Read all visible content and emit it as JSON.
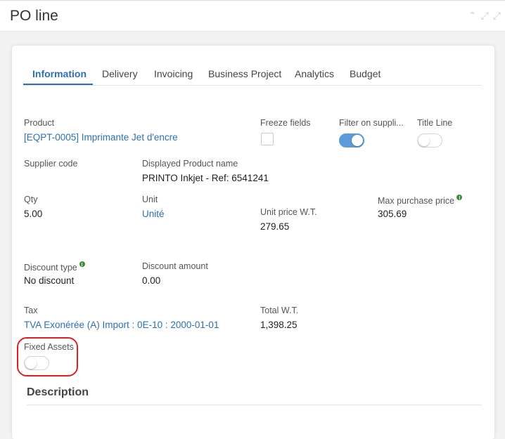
{
  "window": {
    "title": "PO line"
  },
  "tabs": [
    {
      "label": "Information",
      "active": true
    },
    {
      "label": "Delivery"
    },
    {
      "label": "Invoicing"
    },
    {
      "label": "Business Project"
    },
    {
      "label": "Analytics"
    },
    {
      "label": "Budget"
    }
  ],
  "fields": {
    "product": {
      "label": "Product",
      "value": "[EQPT-0005] Imprimante Jet d'encre"
    },
    "freeze_fields": {
      "label": "Freeze fields",
      "checked": false
    },
    "filter_on_supplier": {
      "label": "Filter on suppli...",
      "on": true
    },
    "title_line": {
      "label": "Title Line",
      "on": false
    },
    "supplier_code": {
      "label": "Supplier code",
      "value": ""
    },
    "displayed_product_name": {
      "label": "Displayed Product name",
      "value": "PRINTO Inkjet - Ref: 6541241"
    },
    "qty": {
      "label": "Qty",
      "value": "5.00"
    },
    "unit": {
      "label": "Unit",
      "value": "Unité"
    },
    "unit_price": {
      "label": "Unit price W.T.",
      "value": "279.65"
    },
    "max_purchase_price": {
      "label": "Max purchase price",
      "value": "305.69"
    },
    "discount_type": {
      "label": "Discount type",
      "value": "No discount"
    },
    "discount_amount": {
      "label": "Discount amount",
      "value": "0.00"
    },
    "tax": {
      "label": "Tax",
      "value": "TVA Exonérée (A) Import : 0E-10 : 2000-01-01"
    },
    "total_wt": {
      "label": "Total W.T.",
      "value": "1,398.25"
    },
    "fixed_assets": {
      "label": "Fixed Assets",
      "on": false
    }
  },
  "description": {
    "title": "Description"
  },
  "colors": {
    "accent": "#2b70b2",
    "toggle_on": "#5b9bd9",
    "info": "#3c8f3a",
    "highlight": "#e02020"
  },
  "icons": {
    "collapse": "chevron-up-icon",
    "expand": "expand-arrows-icon",
    "info": "info-icon"
  }
}
